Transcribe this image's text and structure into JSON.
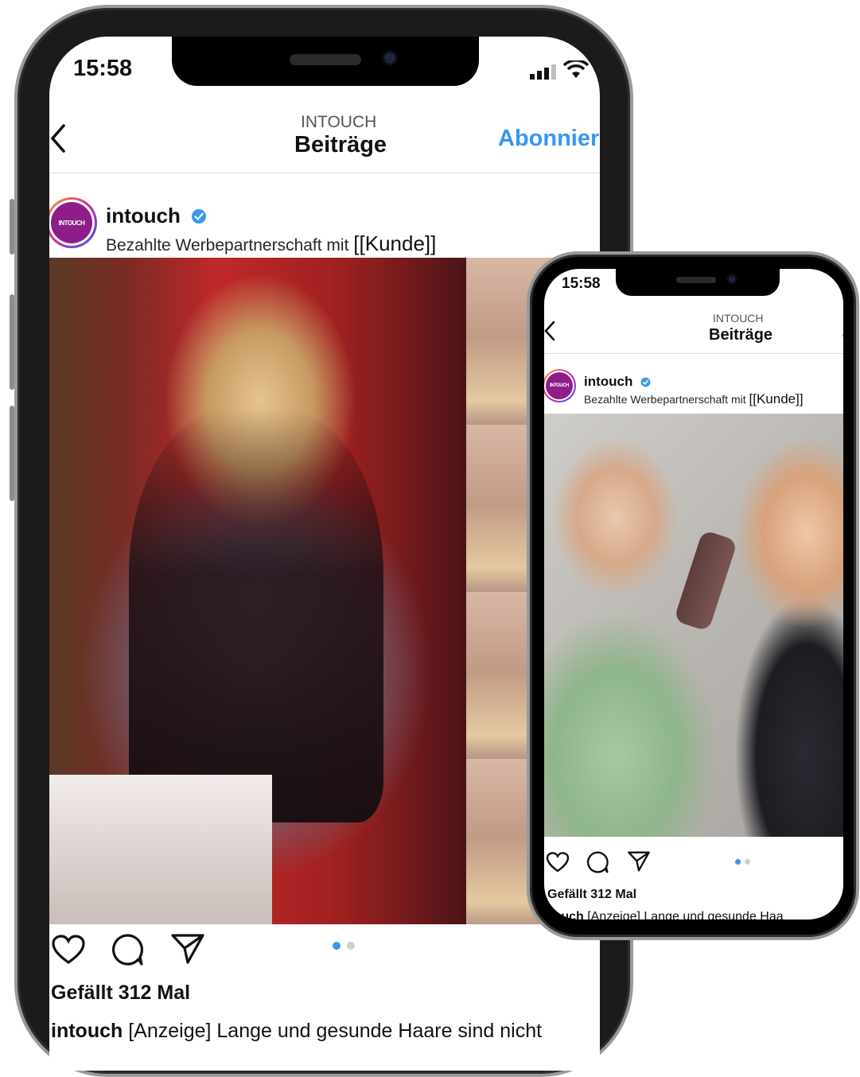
{
  "status": {
    "time": "15:58"
  },
  "nav": {
    "section": "INTOUCH",
    "title": "Beiträge",
    "follow": "Abonnier",
    "follow_small": "A"
  },
  "post": {
    "username": "intouch",
    "subtitle_prefix": "Bezahlte Werbepartnerschaft mit",
    "client": "[[Kunde]]",
    "avatar_text": "INTOUCH",
    "likes": "Gefällt 312 Mal",
    "caption_user": "intouch",
    "caption_text": "[Anzeige] Lange und gesunde Haare sind nicht",
    "caption_text_small": "[Anzeige] Lange und gesunde Haa"
  },
  "icons": [
    "back-chevron-icon",
    "heart-icon",
    "comment-icon",
    "share-icon",
    "verified-badge-icon",
    "signal-icon",
    "wifi-icon"
  ],
  "colors": {
    "accent": "#3897f0",
    "dot_inactive": "#cfcfcf",
    "brand": "#8e1d8a"
  }
}
